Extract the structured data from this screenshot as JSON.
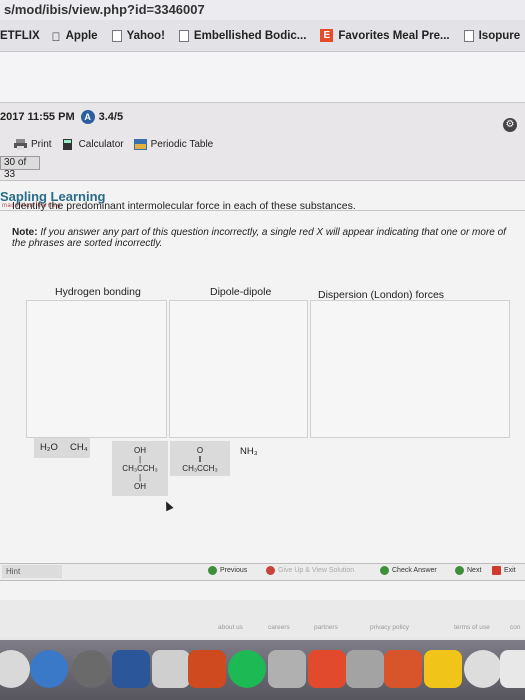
{
  "browser": {
    "url": "s/mod/ibis/view.php?id=3346007",
    "bookmarks": [
      {
        "label": "ETFLIX",
        "icon": "none"
      },
      {
        "label": "Apple",
        "icon": "apple-icon"
      },
      {
        "label": "Yahoo!",
        "icon": "doc-icon"
      },
      {
        "label": "Embellished Bodic...",
        "icon": "doc-icon"
      },
      {
        "label": "Favorites Meal Pre...",
        "icon": "e-icon"
      },
      {
        "label": "Isopure",
        "icon": "doc-icon"
      }
    ]
  },
  "header": {
    "timestamp": "2017 11:55 PM",
    "badge": "A",
    "score": "3.4/5",
    "pager": "30 of 33"
  },
  "tools": {
    "print": "Print",
    "calculator": "Calculator",
    "periodic_table": "Periodic Table"
  },
  "logo": {
    "name": "Sapling Learning",
    "sub": "macmillan learning"
  },
  "question": {
    "prompt": "Identify the predominant intermolecular force in each of these substances.",
    "note_label": "Note:",
    "note_text": " If you answer any part of this question incorrectly, a single red X will appear indicating that one or more of the phrases are sorted incorrectly."
  },
  "bins": [
    {
      "label": "Hydrogen bonding"
    },
    {
      "label": "Dipole-dipole"
    },
    {
      "label": "Dispersion (London) forces"
    }
  ],
  "items": {
    "h2o": "H₂O",
    "ch4": "CH₄",
    "nh3": "NH₃",
    "alcohol_top": "OH",
    "alcohol_mid": "CH₃CCH₃",
    "alcohol_bot": "OH",
    "ketone_top": "O",
    "ketone_bond": "‖",
    "ketone_mid": "CH₃CCH₃"
  },
  "footer": {
    "hint": "Hint",
    "previous": "Previous",
    "give_up": "Give Up & View Solution",
    "check": "Check Answer",
    "next": "Next",
    "exit": "Exit"
  },
  "links": [
    "about us",
    "careers",
    "partners",
    "privacy policy",
    "terms of use",
    "con"
  ],
  "colors": {
    "accent_blue": "#2d5fa0",
    "nav_green": "#3f8f3a",
    "exit_red": "#d23b2b"
  }
}
